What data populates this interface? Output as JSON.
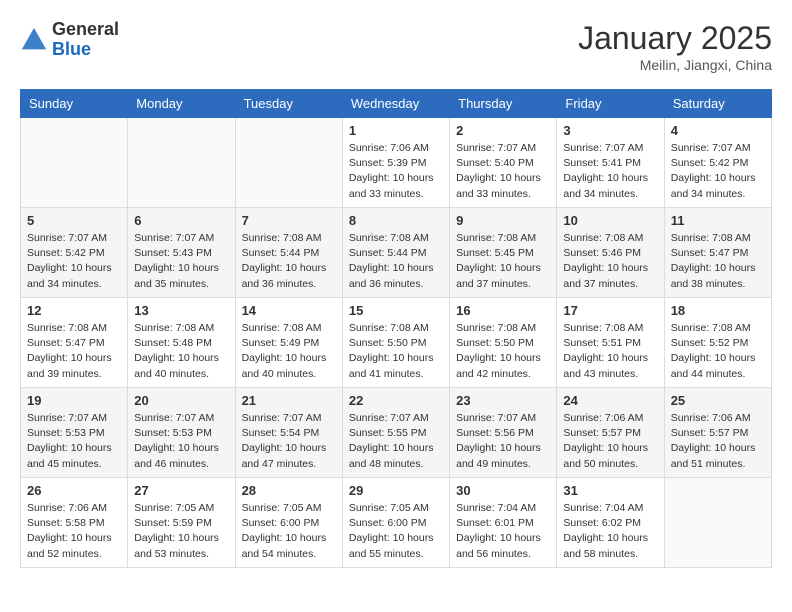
{
  "header": {
    "logo_general": "General",
    "logo_blue": "Blue",
    "month_title": "January 2025",
    "location": "Meilin, Jiangxi, China"
  },
  "days_of_week": [
    "Sunday",
    "Monday",
    "Tuesday",
    "Wednesday",
    "Thursday",
    "Friday",
    "Saturday"
  ],
  "weeks": [
    [
      {
        "day": "",
        "info": ""
      },
      {
        "day": "",
        "info": ""
      },
      {
        "day": "",
        "info": ""
      },
      {
        "day": "1",
        "info": "Sunrise: 7:06 AM\nSunset: 5:39 PM\nDaylight: 10 hours\nand 33 minutes."
      },
      {
        "day": "2",
        "info": "Sunrise: 7:07 AM\nSunset: 5:40 PM\nDaylight: 10 hours\nand 33 minutes."
      },
      {
        "day": "3",
        "info": "Sunrise: 7:07 AM\nSunset: 5:41 PM\nDaylight: 10 hours\nand 34 minutes."
      },
      {
        "day": "4",
        "info": "Sunrise: 7:07 AM\nSunset: 5:42 PM\nDaylight: 10 hours\nand 34 minutes."
      }
    ],
    [
      {
        "day": "5",
        "info": "Sunrise: 7:07 AM\nSunset: 5:42 PM\nDaylight: 10 hours\nand 34 minutes."
      },
      {
        "day": "6",
        "info": "Sunrise: 7:07 AM\nSunset: 5:43 PM\nDaylight: 10 hours\nand 35 minutes."
      },
      {
        "day": "7",
        "info": "Sunrise: 7:08 AM\nSunset: 5:44 PM\nDaylight: 10 hours\nand 36 minutes."
      },
      {
        "day": "8",
        "info": "Sunrise: 7:08 AM\nSunset: 5:44 PM\nDaylight: 10 hours\nand 36 minutes."
      },
      {
        "day": "9",
        "info": "Sunrise: 7:08 AM\nSunset: 5:45 PM\nDaylight: 10 hours\nand 37 minutes."
      },
      {
        "day": "10",
        "info": "Sunrise: 7:08 AM\nSunset: 5:46 PM\nDaylight: 10 hours\nand 37 minutes."
      },
      {
        "day": "11",
        "info": "Sunrise: 7:08 AM\nSunset: 5:47 PM\nDaylight: 10 hours\nand 38 minutes."
      }
    ],
    [
      {
        "day": "12",
        "info": "Sunrise: 7:08 AM\nSunset: 5:47 PM\nDaylight: 10 hours\nand 39 minutes."
      },
      {
        "day": "13",
        "info": "Sunrise: 7:08 AM\nSunset: 5:48 PM\nDaylight: 10 hours\nand 40 minutes."
      },
      {
        "day": "14",
        "info": "Sunrise: 7:08 AM\nSunset: 5:49 PM\nDaylight: 10 hours\nand 40 minutes."
      },
      {
        "day": "15",
        "info": "Sunrise: 7:08 AM\nSunset: 5:50 PM\nDaylight: 10 hours\nand 41 minutes."
      },
      {
        "day": "16",
        "info": "Sunrise: 7:08 AM\nSunset: 5:50 PM\nDaylight: 10 hours\nand 42 minutes."
      },
      {
        "day": "17",
        "info": "Sunrise: 7:08 AM\nSunset: 5:51 PM\nDaylight: 10 hours\nand 43 minutes."
      },
      {
        "day": "18",
        "info": "Sunrise: 7:08 AM\nSunset: 5:52 PM\nDaylight: 10 hours\nand 44 minutes."
      }
    ],
    [
      {
        "day": "19",
        "info": "Sunrise: 7:07 AM\nSunset: 5:53 PM\nDaylight: 10 hours\nand 45 minutes."
      },
      {
        "day": "20",
        "info": "Sunrise: 7:07 AM\nSunset: 5:53 PM\nDaylight: 10 hours\nand 46 minutes."
      },
      {
        "day": "21",
        "info": "Sunrise: 7:07 AM\nSunset: 5:54 PM\nDaylight: 10 hours\nand 47 minutes."
      },
      {
        "day": "22",
        "info": "Sunrise: 7:07 AM\nSunset: 5:55 PM\nDaylight: 10 hours\nand 48 minutes."
      },
      {
        "day": "23",
        "info": "Sunrise: 7:07 AM\nSunset: 5:56 PM\nDaylight: 10 hours\nand 49 minutes."
      },
      {
        "day": "24",
        "info": "Sunrise: 7:06 AM\nSunset: 5:57 PM\nDaylight: 10 hours\nand 50 minutes."
      },
      {
        "day": "25",
        "info": "Sunrise: 7:06 AM\nSunset: 5:57 PM\nDaylight: 10 hours\nand 51 minutes."
      }
    ],
    [
      {
        "day": "26",
        "info": "Sunrise: 7:06 AM\nSunset: 5:58 PM\nDaylight: 10 hours\nand 52 minutes."
      },
      {
        "day": "27",
        "info": "Sunrise: 7:05 AM\nSunset: 5:59 PM\nDaylight: 10 hours\nand 53 minutes."
      },
      {
        "day": "28",
        "info": "Sunrise: 7:05 AM\nSunset: 6:00 PM\nDaylight: 10 hours\nand 54 minutes."
      },
      {
        "day": "29",
        "info": "Sunrise: 7:05 AM\nSunset: 6:00 PM\nDaylight: 10 hours\nand 55 minutes."
      },
      {
        "day": "30",
        "info": "Sunrise: 7:04 AM\nSunset: 6:01 PM\nDaylight: 10 hours\nand 56 minutes."
      },
      {
        "day": "31",
        "info": "Sunrise: 7:04 AM\nSunset: 6:02 PM\nDaylight: 10 hours\nand 58 minutes."
      },
      {
        "day": "",
        "info": ""
      }
    ]
  ]
}
